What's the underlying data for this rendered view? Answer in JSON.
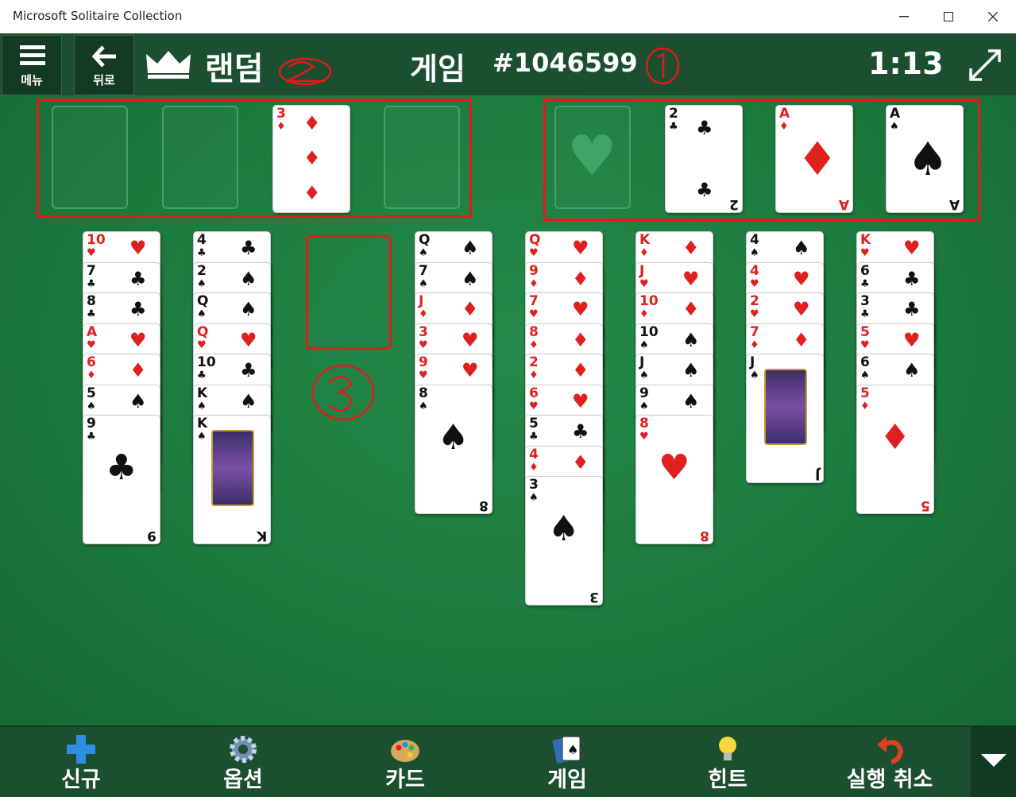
{
  "window": {
    "title": "Microsoft Solitaire Collection"
  },
  "header": {
    "menu_label": "메뉴",
    "back_label": "뒤로",
    "mode": "랜덤",
    "game_label": "게임",
    "game_number": "#1046599",
    "timer": "1:13"
  },
  "freecells": [
    {
      "rank": "",
      "suit": ""
    },
    {
      "rank": "",
      "suit": ""
    },
    {
      "rank": "3",
      "suit": "♦"
    },
    {
      "rank": "",
      "suit": ""
    }
  ],
  "foundations": [
    {
      "rank": "",
      "suit": "♥"
    },
    {
      "rank": "2",
      "suit": "♣"
    },
    {
      "rank": "A",
      "suit": "♦"
    },
    {
      "rank": "A",
      "suit": "♠"
    }
  ],
  "tableau": [
    [
      "10♥",
      "7♣",
      "8♣",
      "A♥",
      "6♦",
      "5♠",
      "9♣"
    ],
    [
      "4♣",
      "2♠",
      "Q♠",
      "Q♥",
      "10♣",
      "K♠",
      "K♠"
    ],
    [],
    [
      "Q♠",
      "7♠",
      "J♦",
      "3♥",
      "9♥",
      "8♠"
    ],
    [
      "Q♥",
      "9♦",
      "7♥",
      "8♦",
      "2♦",
      "6♥",
      "5♣",
      "4♦",
      "3♠"
    ],
    [
      "K♦",
      "J♥",
      "10♦",
      "10♠",
      "J♠",
      "9♠",
      "8♥"
    ],
    [
      "4♠",
      "4♥",
      "2♥",
      "7♦",
      "J♠"
    ],
    [
      "K♥",
      "6♣",
      "3♣",
      "5♥",
      "6♠",
      "5♦"
    ]
  ],
  "annotations": [
    "①",
    "②",
    "③"
  ],
  "toolbar": {
    "new_label": "신규",
    "options_label": "옵션",
    "cards_label": "카드",
    "game_label": "게임",
    "hint_label": "힌트",
    "undo_label": "실행 취소"
  },
  "colors": {
    "felt": "#1f7a3f",
    "bar": "#1b4f2f",
    "red_suit": "#e0201f",
    "annotation": "#e01b1b"
  }
}
